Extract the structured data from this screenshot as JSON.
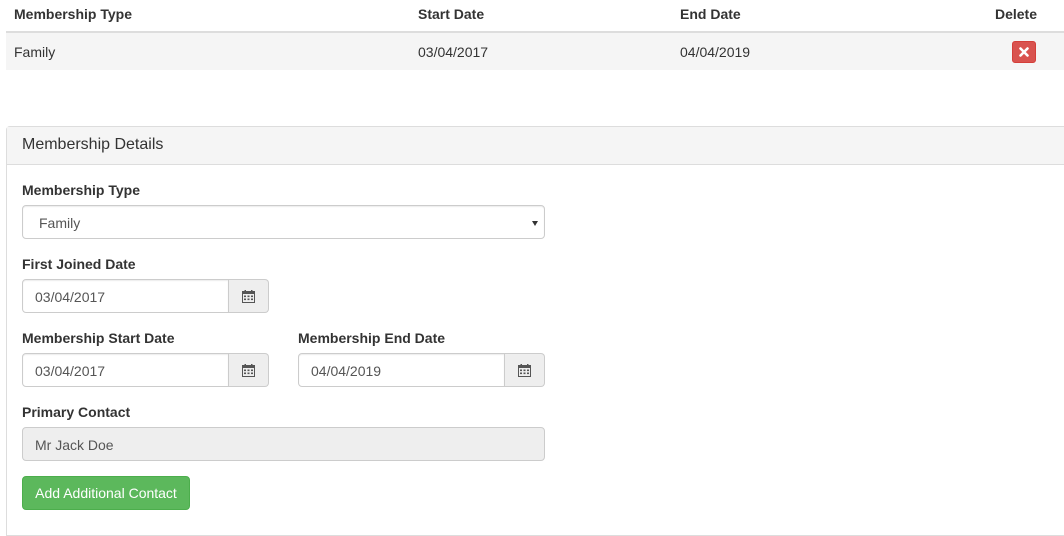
{
  "table": {
    "headers": {
      "membership_type": "Membership Type",
      "start_date": "Start Date",
      "end_date": "End Date",
      "delete": "Delete"
    },
    "rows": [
      {
        "membership_type": "Family",
        "start_date": "03/04/2017",
        "end_date": "04/04/2019",
        "delete_icon": "times-icon"
      }
    ]
  },
  "panel": {
    "title": "Membership Details",
    "membership_type": {
      "label": "Membership Type",
      "value": "Family"
    },
    "first_joined_date": {
      "label": "First Joined Date",
      "value": "03/04/2017",
      "icon": "calendar-icon"
    },
    "start_date": {
      "label": "Membership Start Date",
      "value": "03/04/2017",
      "icon": "calendar-icon"
    },
    "end_date": {
      "label": "Membership End Date",
      "value": "04/04/2019",
      "icon": "calendar-icon"
    },
    "primary_contact": {
      "label": "Primary Contact",
      "value": "Mr Jack Doe"
    },
    "add_contact_button": "Add Additional Contact"
  },
  "colors": {
    "danger": "#d9534f",
    "success": "#5cb85c",
    "panel_header_bg": "#f5f5f5",
    "border": "#dddddd"
  }
}
